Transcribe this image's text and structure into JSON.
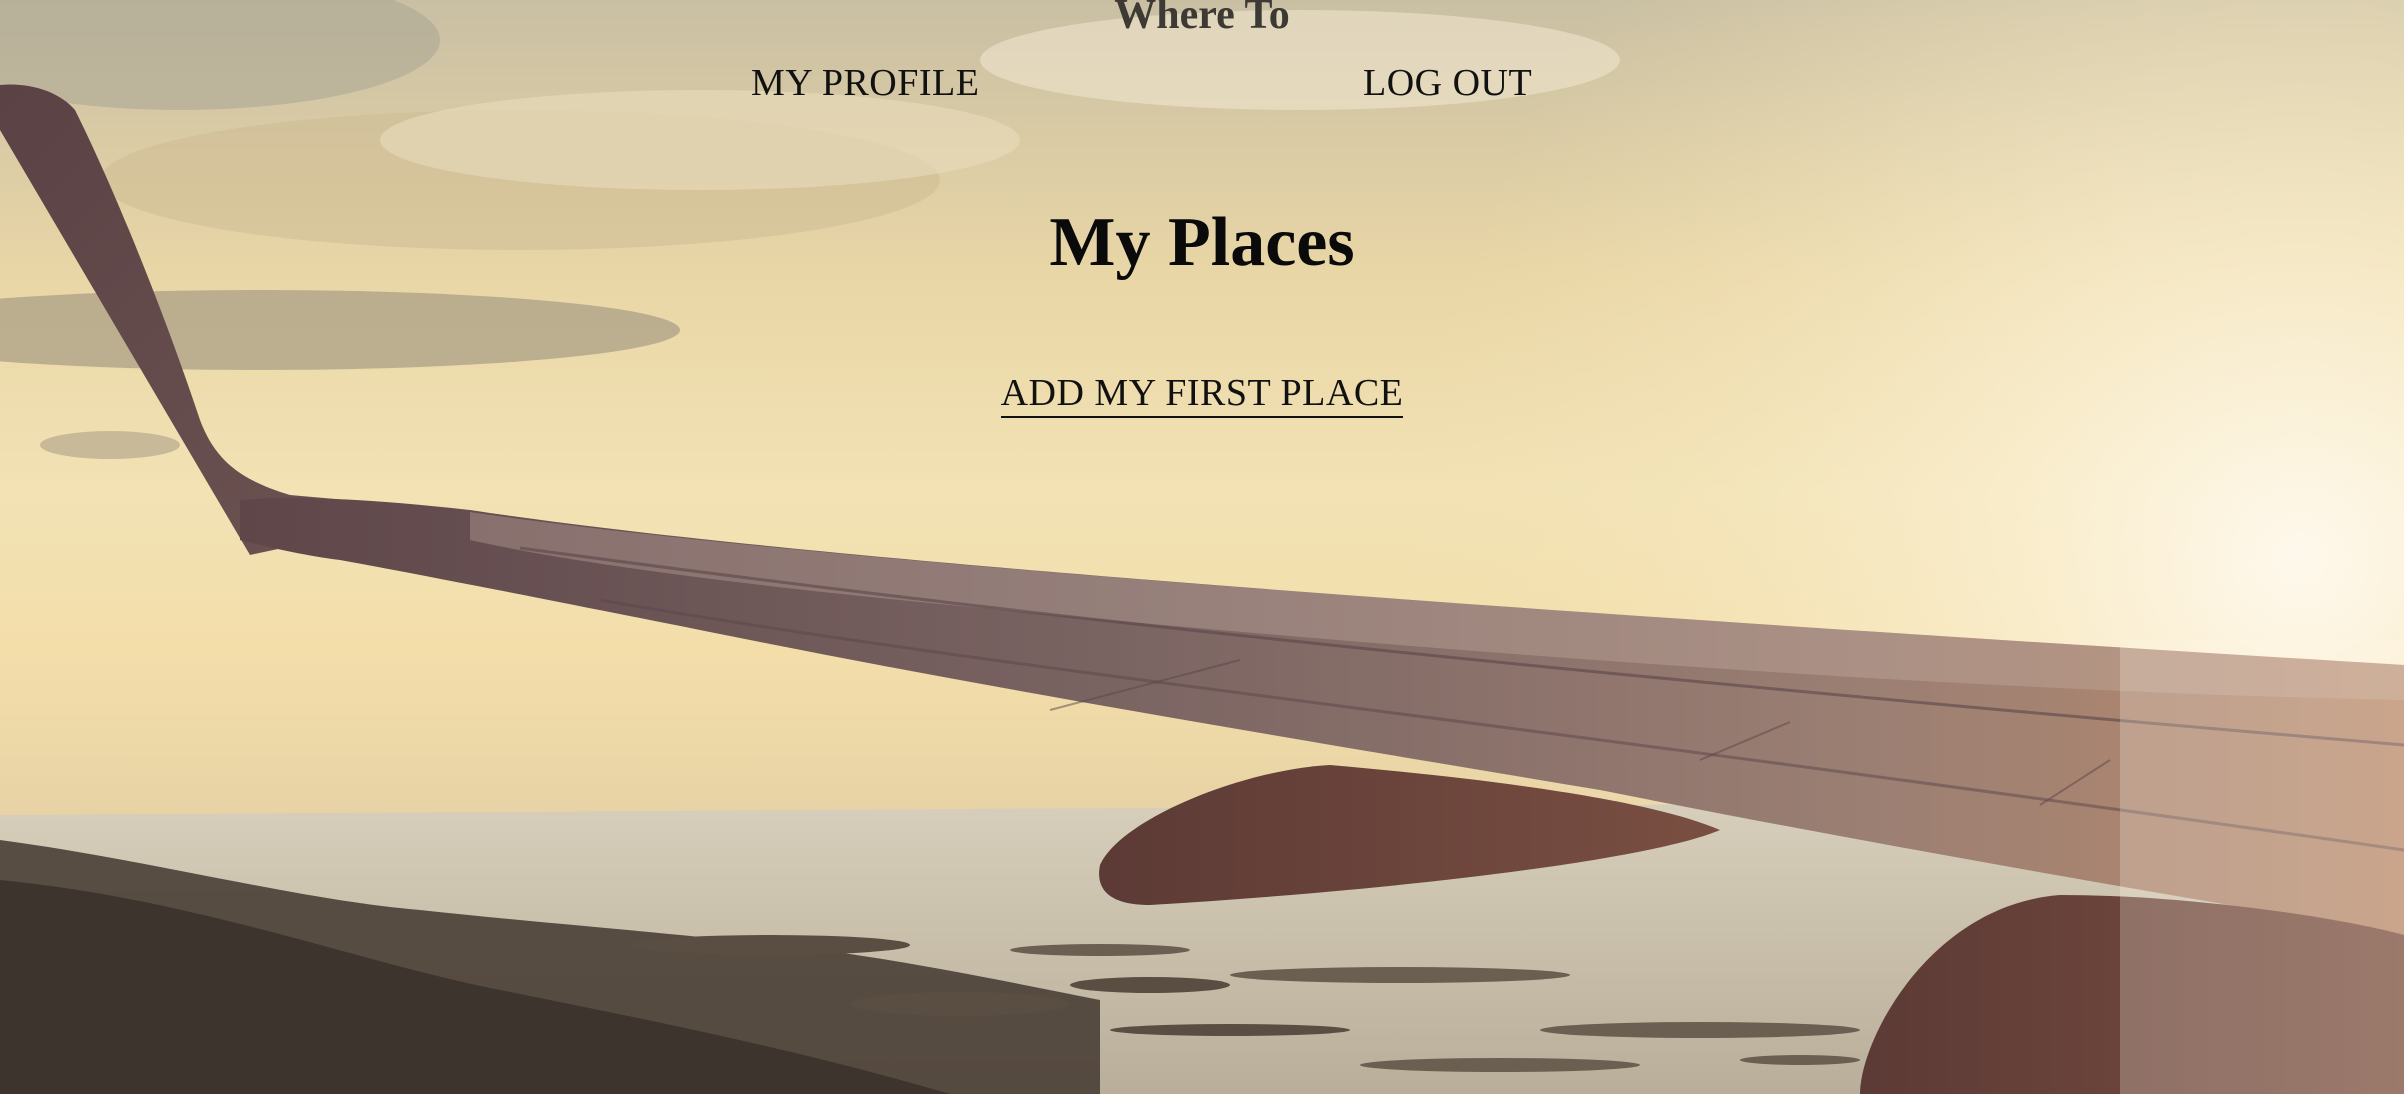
{
  "site": {
    "title": "Where To"
  },
  "nav": {
    "profile_label": "MY PROFILE",
    "logout_label": "LOG OUT"
  },
  "main": {
    "heading": "My Places",
    "add_place_label": "ADD MY FIRST PLACE"
  },
  "background": {
    "subject": "airplane wing over coastline at sunset",
    "colors": {
      "sky": "#f2e2b4",
      "cloud_shadow": "#8c8374",
      "wing": "#6b5152",
      "land": "#4a3f36",
      "water": "#c8bfae"
    }
  }
}
